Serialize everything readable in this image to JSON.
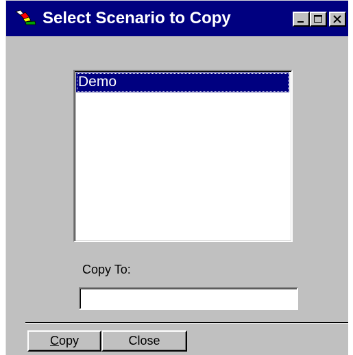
{
  "window": {
    "title": "Select Scenario to Copy",
    "icon": "scenario-app-icon",
    "controls": {
      "minimize_icon": "minimize-icon",
      "maximize_icon": "maximize-icon",
      "close_icon": "close-icon"
    }
  },
  "scenarios": {
    "items": [
      {
        "label": "Demo",
        "selected": true
      }
    ]
  },
  "copy_to": {
    "label": "Copy To:",
    "value": ""
  },
  "buttons": {
    "copy": {
      "mnemonic": "C",
      "rest": "opy"
    },
    "close": {
      "label": "Close"
    }
  },
  "colors": {
    "titlebar": "#000080",
    "dialog_face": "#c0c0c0",
    "selection": "#000080"
  }
}
